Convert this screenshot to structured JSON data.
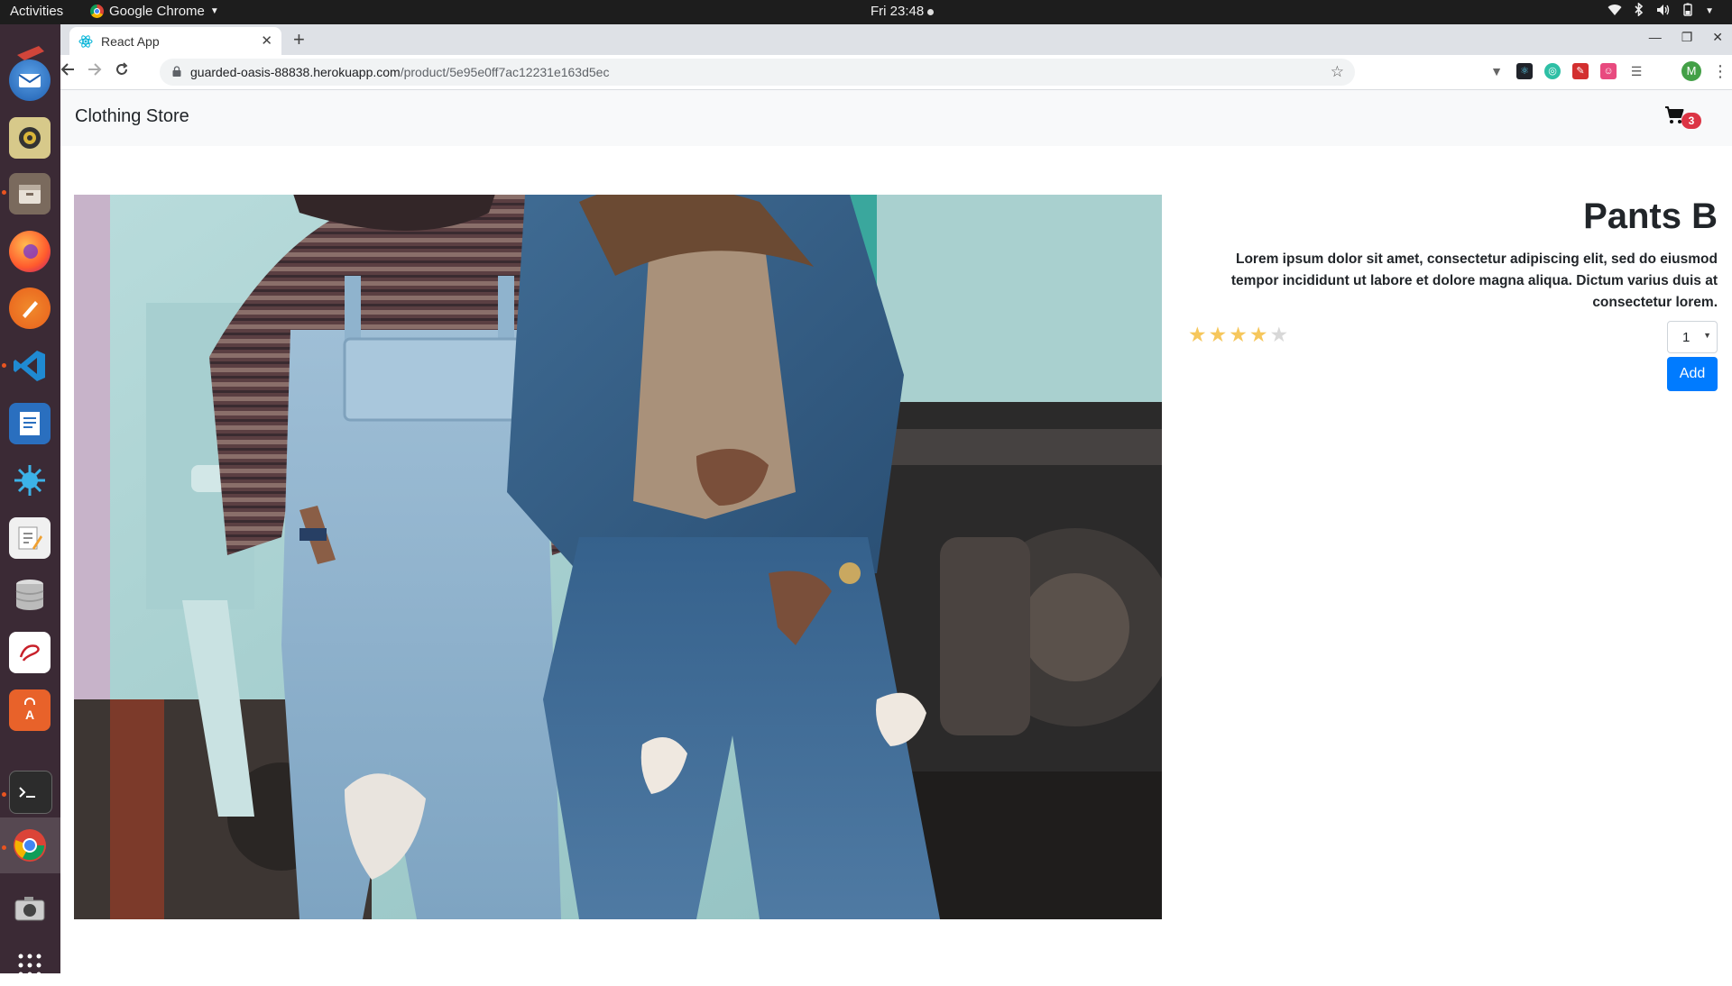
{
  "topbar": {
    "activities": "Activities",
    "app_name": "Google Chrome",
    "clock": "Fri 23:48"
  },
  "dock": {
    "items": [
      "thunderbird-icon",
      "rhythmbox-icon",
      "files-icon",
      "firefox-icon",
      "inkscape-icon",
      "vscode-icon",
      "writer-icon",
      "kdenlive-icon",
      "text-editor-icon",
      "database-icon",
      "evince-icon",
      "software-center-icon",
      "terminal-icon",
      "chrome-icon",
      "screenshot-icon",
      "show-apps-icon"
    ]
  },
  "browser": {
    "tab_title": "React App",
    "url_host": "guarded-oasis-88838.herokuapp.com",
    "url_path": "/product/5e95e0ff7ac12231e163d5ec",
    "profile_initial": "M"
  },
  "navbar": {
    "brand": "Clothing Store",
    "cart_count": "3"
  },
  "product": {
    "title": "Pants B",
    "description": "Lorem ipsum dolor sit amet, consectetur adipiscing elit, sed do eiusmod tempor incididunt ut labore et dolore magna aliqua. Dictum varius duis at consectetur lorem.",
    "rating": 4,
    "rating_max": 5,
    "quantity": "1",
    "add_label": "Add"
  },
  "colors": {
    "primary": "#007bff",
    "badge": "#dc3545",
    "star": "#f6c75c"
  }
}
